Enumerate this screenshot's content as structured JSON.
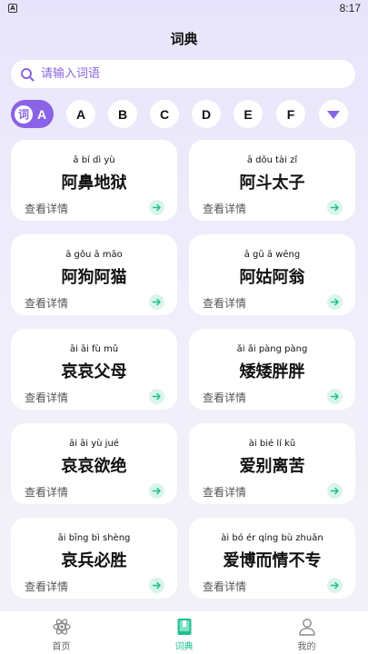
{
  "status_bar": {
    "app_icon_letter": "A",
    "time": "8:17"
  },
  "header": {
    "title": "词典"
  },
  "search": {
    "placeholder": "请输入词语",
    "value": ""
  },
  "letters": {
    "badge_text": "词",
    "selected": "A",
    "others": [
      "A",
      "B",
      "C",
      "D",
      "E",
      "F"
    ]
  },
  "cards": [
    {
      "pinyin": "ā bí dì yù",
      "word": "阿鼻地狱",
      "detail": "查看详情"
    },
    {
      "pinyin": "ā dǒu tài zǐ",
      "word": "阿斗太子",
      "detail": "查看详情"
    },
    {
      "pinyin": "ā gǒu ā māo",
      "word": "阿狗阿猫",
      "detail": "查看详情"
    },
    {
      "pinyin": "ā gū ā wēng",
      "word": "阿姑阿翁",
      "detail": "查看详情"
    },
    {
      "pinyin": "āi āi fù mǔ",
      "word": "哀哀父母",
      "detail": "查看详情"
    },
    {
      "pinyin": "ǎi ǎi pàng pàng",
      "word": "矮矮胖胖",
      "detail": "查看详情"
    },
    {
      "pinyin": "āi āi yù jué",
      "word": "哀哀欲绝",
      "detail": "查看详情"
    },
    {
      "pinyin": "ài bié lí kǔ",
      "word": "爱别离苦",
      "detail": "查看详情"
    },
    {
      "pinyin": "āi bīng bì shèng",
      "word": "哀兵必胜",
      "detail": "查看详情"
    },
    {
      "pinyin": "ài bó ér qíng bù zhuān",
      "word": "爱博而情不专",
      "detail": "查看详情"
    }
  ],
  "bottom_nav": {
    "items": [
      {
        "label": "首页",
        "icon": "atom-icon",
        "active": false
      },
      {
        "label": "词典",
        "icon": "book-icon",
        "active": true
      },
      {
        "label": "我的",
        "icon": "person-icon",
        "active": false
      }
    ]
  },
  "colors": {
    "accent_purple": "#8b63e6",
    "accent_green": "#1fbf8f",
    "arrow_bg": "#d9f5ea"
  }
}
